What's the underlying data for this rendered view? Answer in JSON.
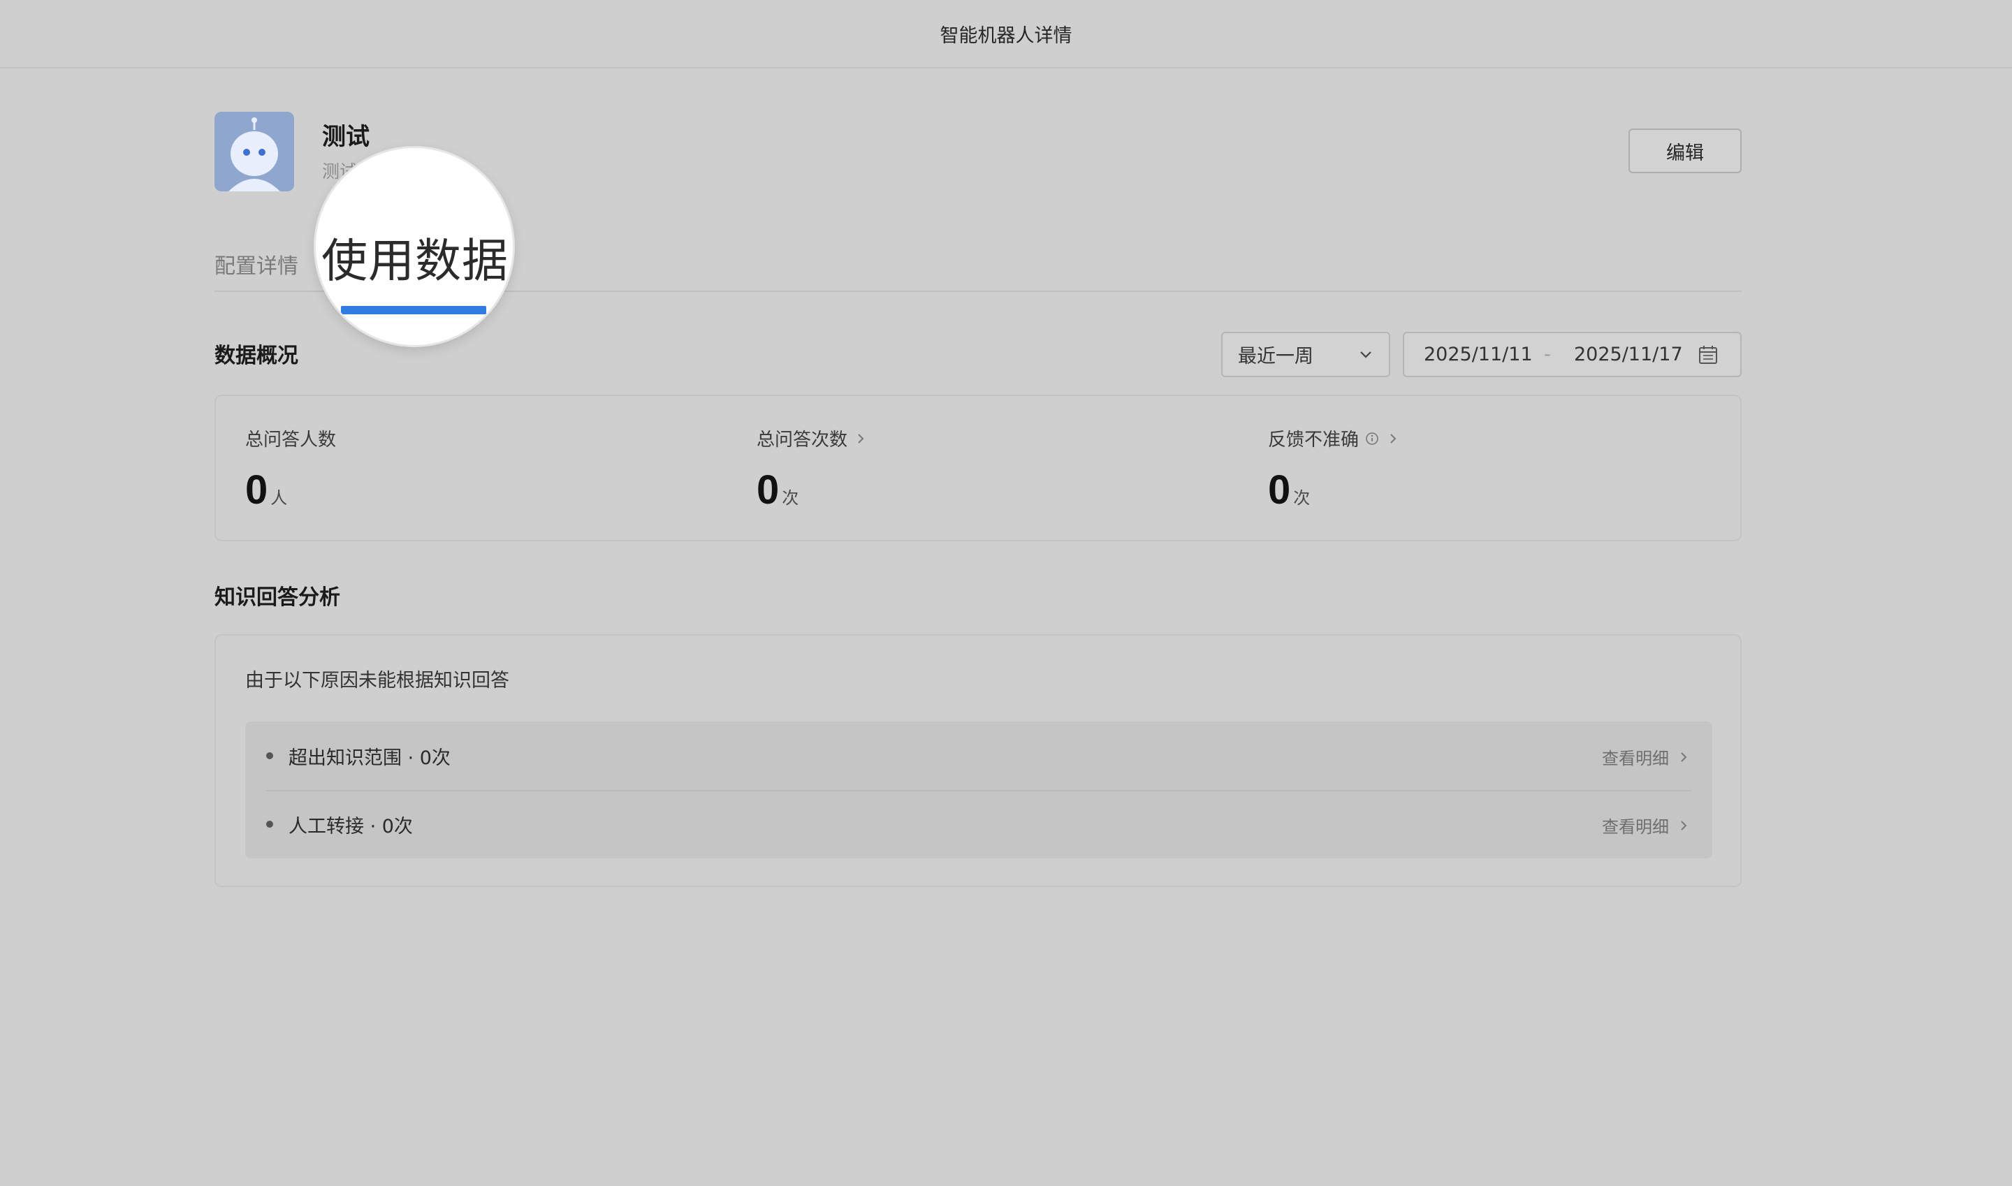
{
  "window": {
    "title": "智能机器人详情"
  },
  "bot": {
    "name": "测试",
    "description": "测试"
  },
  "header": {
    "edit_label": "编辑"
  },
  "tabs": {
    "config_label": "配置详情",
    "usage_label": "使用数据"
  },
  "overview": {
    "title": "数据概况",
    "range_select_value": "最近一周",
    "date_start": "2025/11/11",
    "date_separator": "-",
    "date_end": "2025/11/17",
    "stats": [
      {
        "label": "总问答人数",
        "value": "0",
        "unit": "人"
      },
      {
        "label": "总问答次数",
        "value": "0",
        "unit": "次"
      },
      {
        "label": "反馈不准确",
        "value": "0",
        "unit": "次"
      }
    ]
  },
  "analysis": {
    "title": "知识回答分析",
    "intro": "由于以下原因未能根据知识回答",
    "reasons": [
      {
        "text": "超出知识范围 · 0次",
        "detail_label": "查看明细"
      },
      {
        "text": "人工转接 · 0次",
        "detail_label": "查看明细"
      }
    ]
  },
  "icons": [
    "robot-avatar-icon",
    "chevron-down-icon",
    "calendar-icon",
    "chevron-right-icon",
    "info-icon"
  ],
  "colors": {
    "accent": "#2f7de1",
    "background": "#cfcfcf",
    "avatar_bg": "#8fa7cf"
  }
}
